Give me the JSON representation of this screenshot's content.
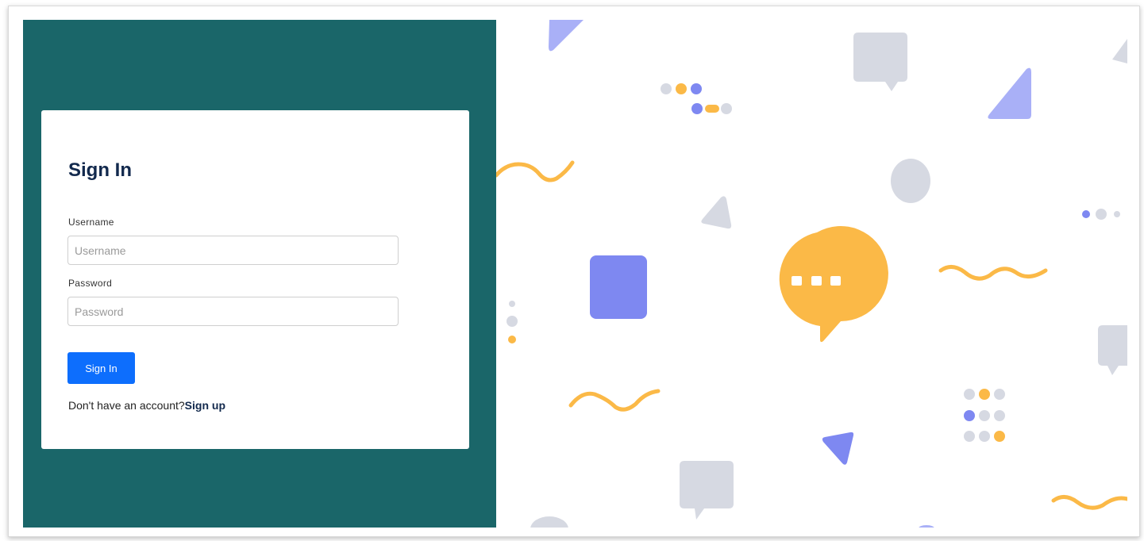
{
  "login": {
    "title": "Sign In",
    "username": {
      "label": "Username",
      "placeholder": "Username",
      "value": ""
    },
    "password": {
      "label": "Password",
      "placeholder": "Password",
      "value": ""
    },
    "submit_label": "Sign In",
    "signup_prompt": "Don't have an account?",
    "signup_link": "Sign up"
  },
  "colors": {
    "panel_bg": "#1a6669",
    "title": "#12294d",
    "button": "#0d6efd",
    "accent_yellow": "#fbb947",
    "accent_purple": "#7e88f1",
    "accent_lavender": "#a9b0f7",
    "decor_gray": "#d6d9e2"
  },
  "illustration": {
    "icons": [
      "chat-bubble-icon",
      "triangle-shape",
      "square-shape",
      "circle-shape",
      "wave-shape",
      "dots-shape"
    ]
  }
}
